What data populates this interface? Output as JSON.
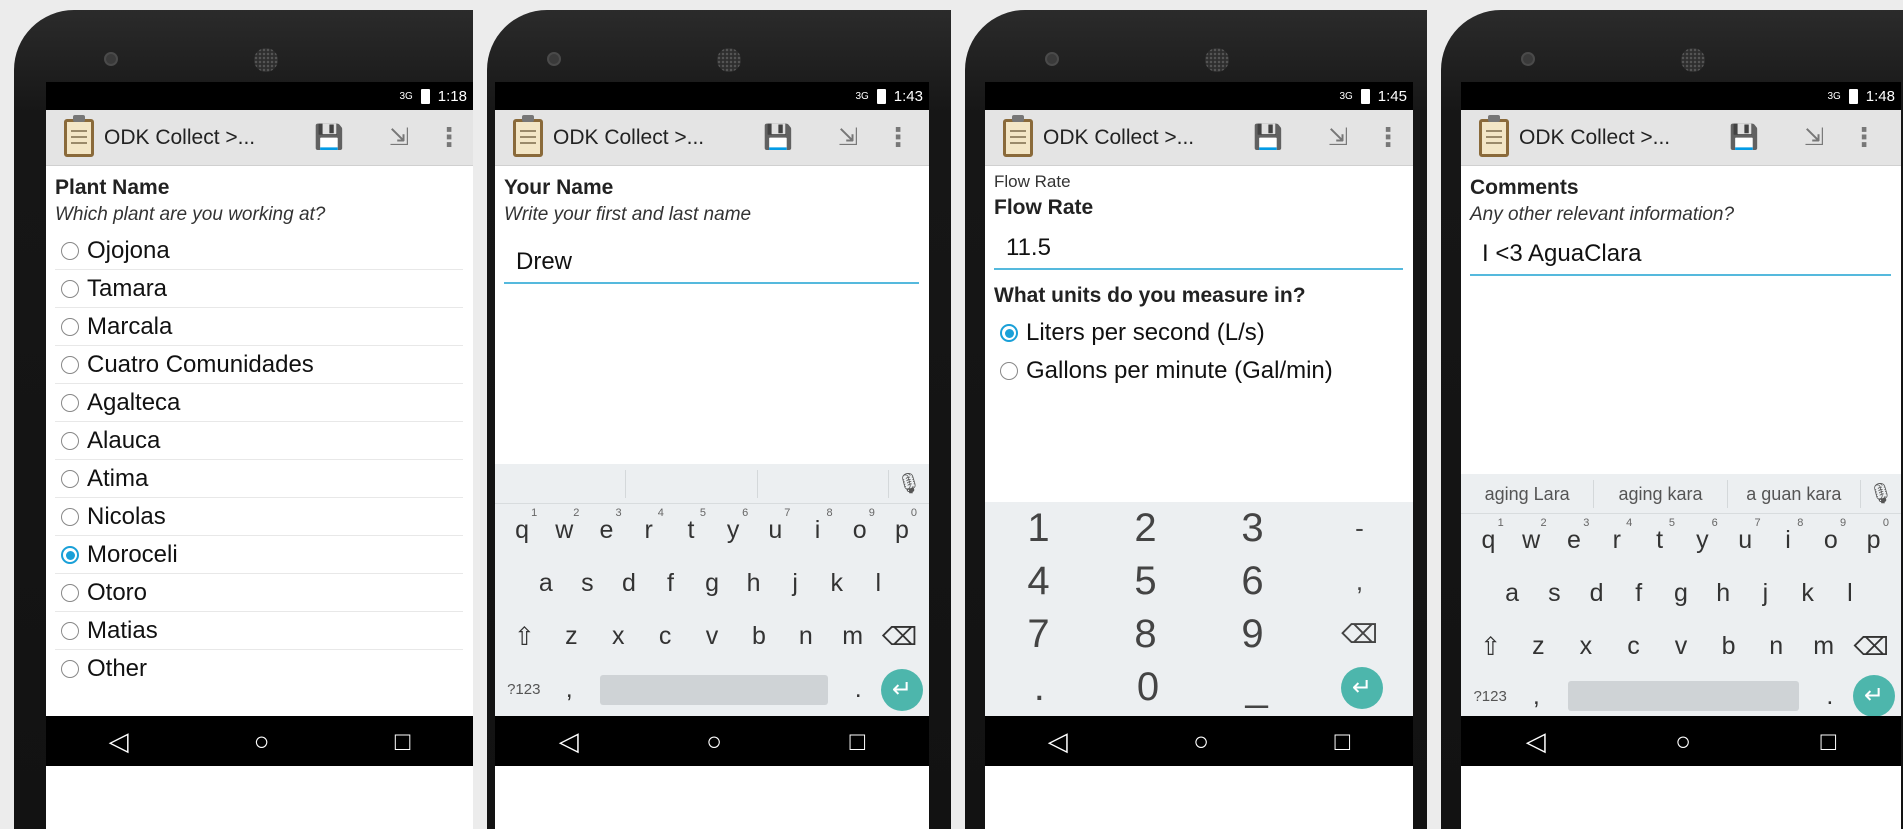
{
  "common": {
    "app_title": "ODK Collect >...",
    "save_icon": "💾",
    "goto_icon": "⇲",
    "overflow_icon": "⋮",
    "signal": "3G",
    "back_icon": "◁",
    "home_icon": "○",
    "recents_icon": "□",
    "mic_icon": "🎙",
    "shift_icon": "⇧",
    "delete_icon": "⌫",
    "enter_icon": "↵",
    "symbols_key": "?123",
    "comma_key": ",",
    "period_key": "."
  },
  "screens": [
    {
      "time": "1:18",
      "question_label": "Plant Name",
      "question_hint": "Which plant are you working at?",
      "options": [
        {
          "label": "Ojojona",
          "selected": false
        },
        {
          "label": "Tamara",
          "selected": false
        },
        {
          "label": "Marcala",
          "selected": false
        },
        {
          "label": "Cuatro Comunidades",
          "selected": false
        },
        {
          "label": "Agalteca",
          "selected": false
        },
        {
          "label": "Alauca",
          "selected": false
        },
        {
          "label": "Atima",
          "selected": false
        },
        {
          "label": "Nicolas",
          "selected": false
        },
        {
          "label": "Moroceli",
          "selected": true
        },
        {
          "label": "Otoro",
          "selected": false
        },
        {
          "label": "Matias",
          "selected": false
        },
        {
          "label": "Other",
          "selected": false
        }
      ]
    },
    {
      "time": "1:43",
      "question_label": "Your Name",
      "question_hint": "Write your first and last name",
      "input_value": "Drew",
      "suggestions": [
        "",
        "",
        ""
      ]
    },
    {
      "time": "1:45",
      "group_label": "Flow Rate",
      "question_label": "Flow Rate",
      "input_value": "11.5",
      "question2_label": "What units do you measure in?",
      "options": [
        {
          "label": "Liters per second (L/s)",
          "selected": true
        },
        {
          "label": "Gallons per minute (Gal/min)",
          "selected": false
        }
      ],
      "numpad": [
        [
          "1",
          "2",
          "3",
          "-"
        ],
        [
          "4",
          "5",
          "6",
          ","
        ],
        [
          "7",
          "8",
          "9",
          "⌫"
        ],
        [
          ".",
          "0",
          "_",
          "↵"
        ]
      ]
    },
    {
      "time": "1:48",
      "question_label": "Comments",
      "question_hint": "Any other relevant information?",
      "input_value": "I <3 AguaClara",
      "suggestions": [
        "aging Lara",
        "aging kara",
        "a guan kara"
      ]
    }
  ],
  "keyboard_rows": {
    "row1": [
      [
        "q",
        "1"
      ],
      [
        "w",
        "2"
      ],
      [
        "e",
        "3"
      ],
      [
        "r",
        "4"
      ],
      [
        "t",
        "5"
      ],
      [
        "y",
        "6"
      ],
      [
        "u",
        "7"
      ],
      [
        "i",
        "8"
      ],
      [
        "o",
        "9"
      ],
      [
        "p",
        "0"
      ]
    ],
    "row2": [
      "a",
      "s",
      "d",
      "f",
      "g",
      "h",
      "j",
      "k",
      "l"
    ],
    "row3": [
      "z",
      "x",
      "c",
      "v",
      "b",
      "n",
      "m"
    ]
  }
}
